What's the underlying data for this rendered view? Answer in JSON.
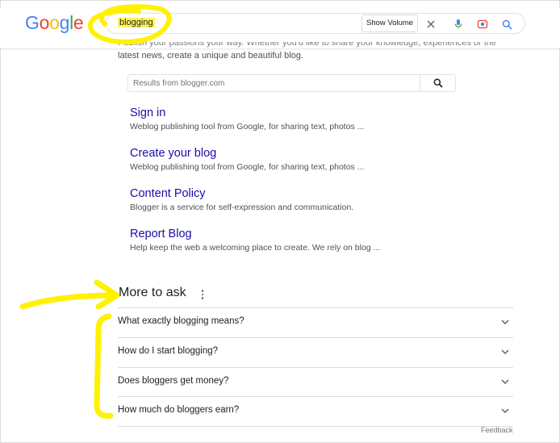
{
  "header": {
    "logo_letters": [
      {
        "char": "G",
        "color": "#4285F4"
      },
      {
        "char": "o",
        "color": "#EA4335"
      },
      {
        "char": "o",
        "color": "#FBBC05"
      },
      {
        "char": "g",
        "color": "#4285F4"
      },
      {
        "char": "l",
        "color": "#34A853"
      },
      {
        "char": "e",
        "color": "#EA4335"
      }
    ],
    "query": "blogging",
    "show_volume_label": "Show Volume",
    "icons": [
      "close-icon",
      "mic-icon",
      "lens-icon",
      "search-icon"
    ]
  },
  "top_snippet": {
    "line1_clipped": "Publish your passions your way. Whether you'd like to share your knowledge, experiences or the",
    "line2": "latest news, create a unique and beautiful blog."
  },
  "site_search": {
    "placeholder": "Results from blogger.com"
  },
  "sitelinks": [
    {
      "title": "Sign in",
      "description": "Weblog publishing tool from Google, for sharing text, photos ..."
    },
    {
      "title": "Create your blog",
      "description": "Weblog publishing tool from Google, for sharing text, photos ..."
    },
    {
      "title": "Content Policy",
      "description": "Blogger is a service for self-expression and communication."
    },
    {
      "title": "Report Blog",
      "description": "Help keep the web a welcoming place to create. We rely on blog ..."
    }
  ],
  "more_to_ask": {
    "title": "More to ask",
    "questions": [
      "What exactly blogging means?",
      "How do I start blogging?",
      "Does bloggers get money?",
      "How much do bloggers earn?"
    ]
  },
  "feedback_label": "Feedback",
  "colors": {
    "annotation_yellow": "#FFF100",
    "link_blue": "#1a0dab",
    "highlight": "#fff35a"
  }
}
